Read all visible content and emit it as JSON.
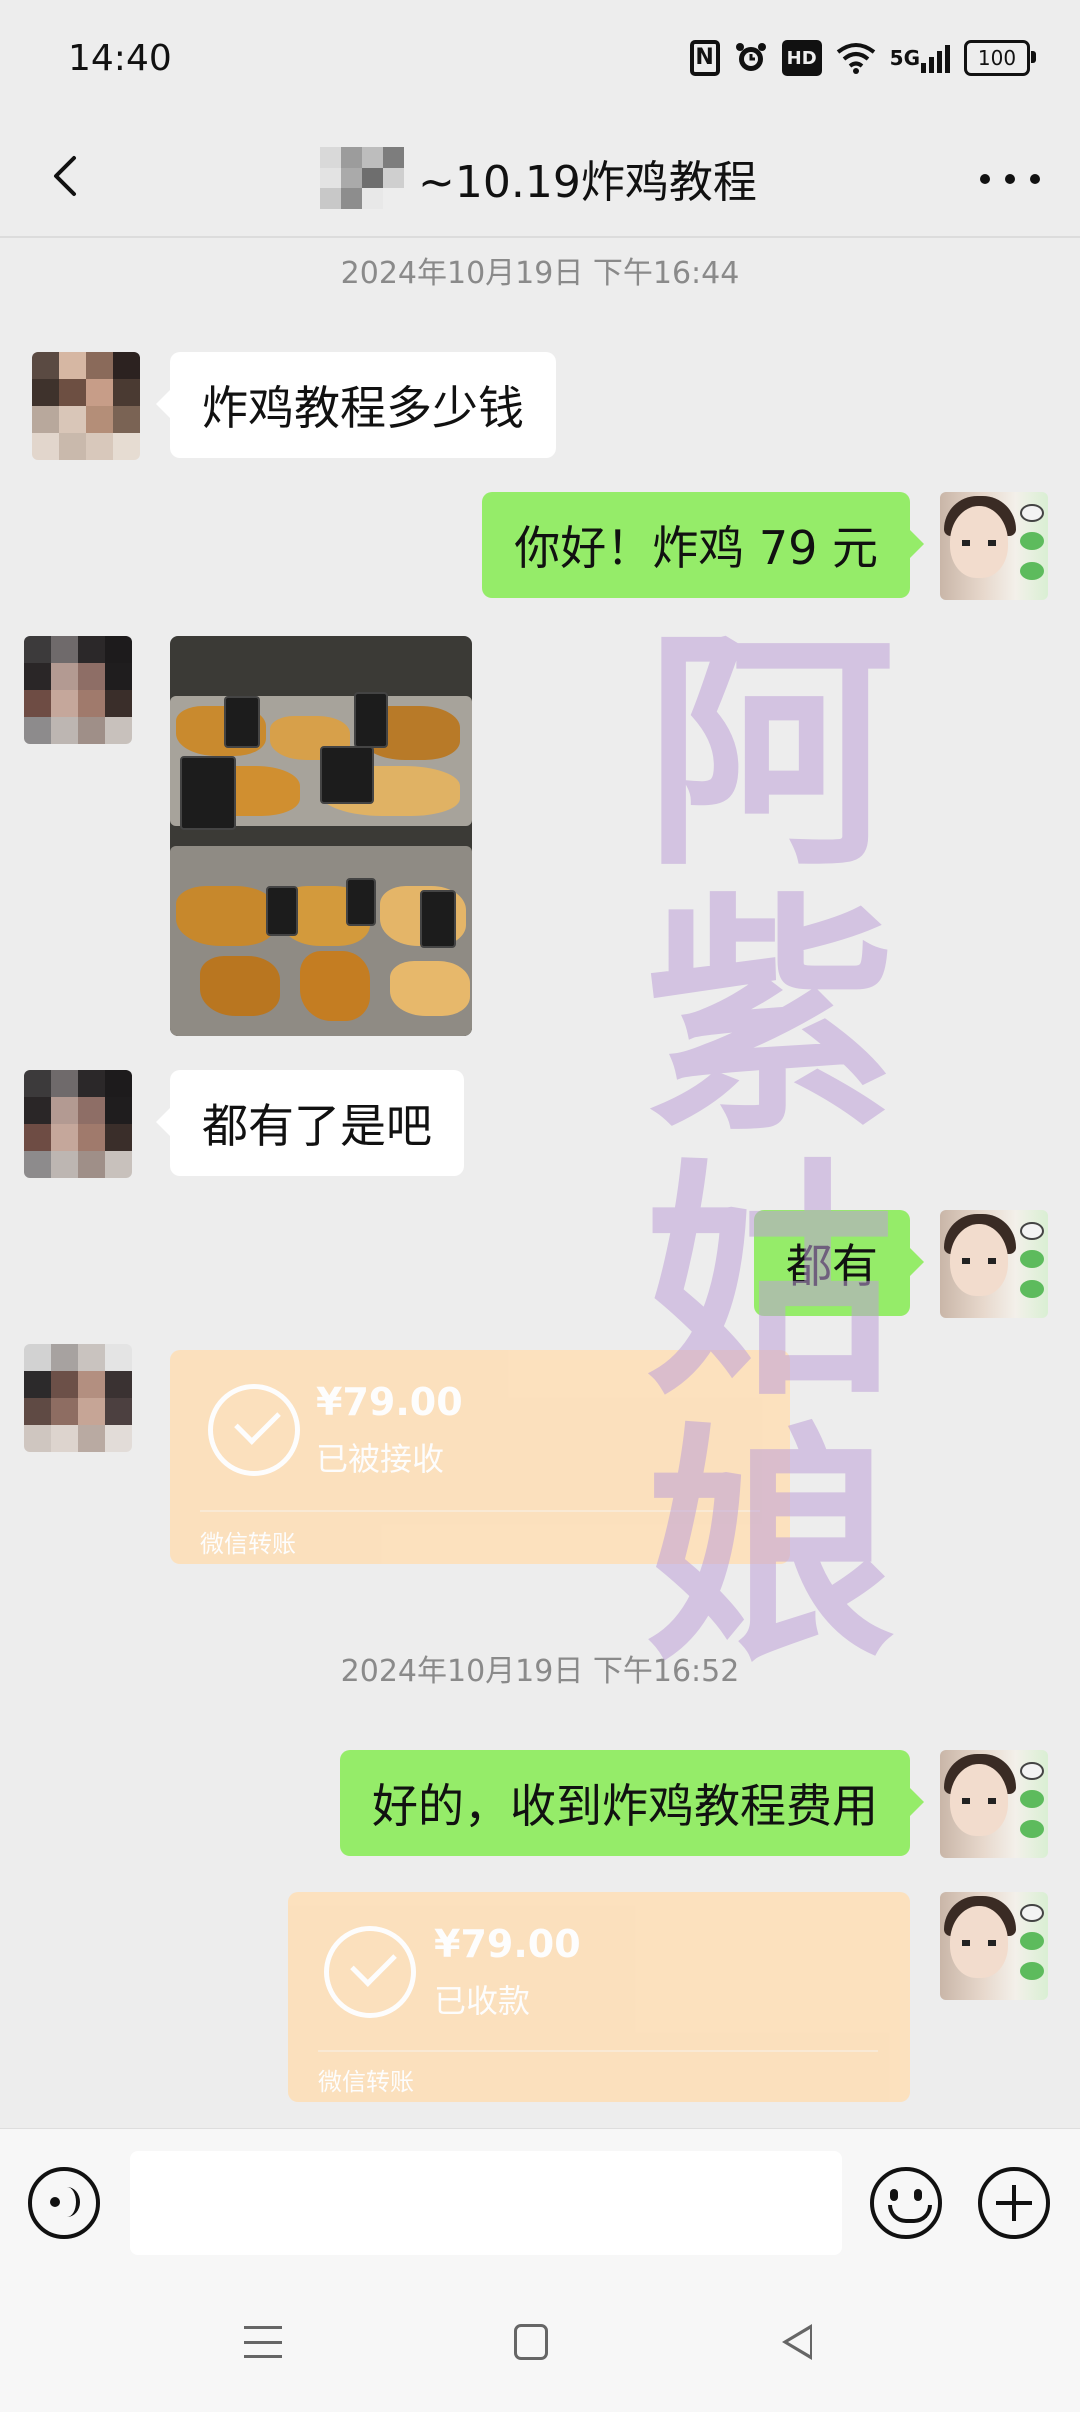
{
  "status_bar": {
    "time": "14:40",
    "icons": [
      "nfc-icon",
      "alarm-icon",
      "hd-icon",
      "wifi-icon",
      "5g-signal-icon",
      "battery-icon"
    ],
    "hd": "HD",
    "network": "5G",
    "battery": "100"
  },
  "header": {
    "title": "~10.19炸鸡教程",
    "back_icon": "back-arrow-icon",
    "more_icon": "more-icon"
  },
  "chat": {
    "timestamp_1": "2024年10月19日 下午16:44",
    "msg_1": "炸鸡教程多少钱",
    "msg_2": "你好！炸鸡 79 元",
    "msg_4": "都有了是吧",
    "msg_5": "都有",
    "transfer_1": {
      "amount": "¥79.00",
      "status": "已被接收",
      "label": "微信转账"
    },
    "timestamp_2": "2024年10月19日 下午16:52",
    "msg_7": "好的，收到炸鸡教程费用",
    "transfer_2": {
      "amount": "¥79.00",
      "status": "已收款",
      "label": "微信转账"
    }
  },
  "watermark": [
    "阿",
    "紫",
    "姑",
    "娘"
  ],
  "colors": {
    "background": "#ededed",
    "incoming_bubble": "#ffffff",
    "outgoing_bubble": "#95ec69",
    "transfer_card": "#fddfba",
    "watermark": "#bea0d7"
  }
}
